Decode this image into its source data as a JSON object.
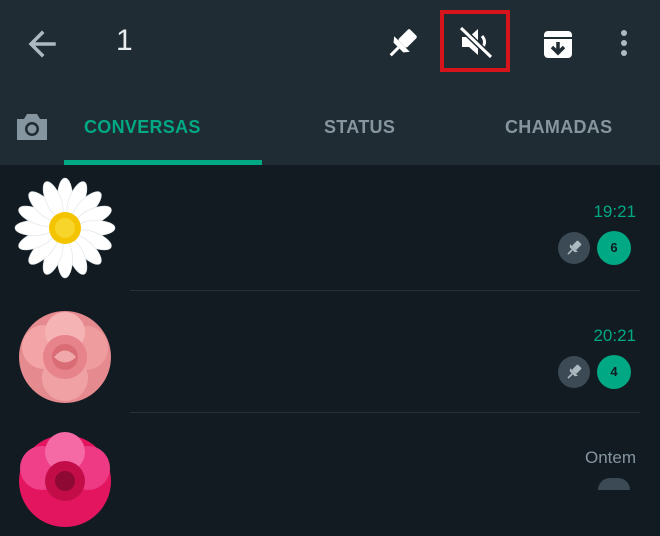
{
  "header": {
    "selected_count": "1",
    "icons": [
      "arrow-back-icon",
      "pin-icon",
      "mute-icon",
      "archive-icon",
      "more-vert-icon"
    ],
    "highlight_color": "#d6141c"
  },
  "tabs": [
    {
      "label": "CONVERSAS",
      "active": true
    },
    {
      "label": "STATUS",
      "active": false
    },
    {
      "label": "CHAMADAS",
      "active": false
    }
  ],
  "chats": [
    {
      "avatar": "white-daisy-flower",
      "time": "19:21",
      "pinned": true,
      "unread": "6"
    },
    {
      "avatar": "pink-rose-flower",
      "time": "20:21",
      "pinned": true,
      "unread": "4"
    },
    {
      "avatar": "magenta-rose-flower",
      "time": "Ontem",
      "pinned": false,
      "unread": ""
    }
  ],
  "colors": {
    "accent": "#00a884",
    "header_bg": "#1f2c33",
    "list_bg": "#121b22"
  }
}
